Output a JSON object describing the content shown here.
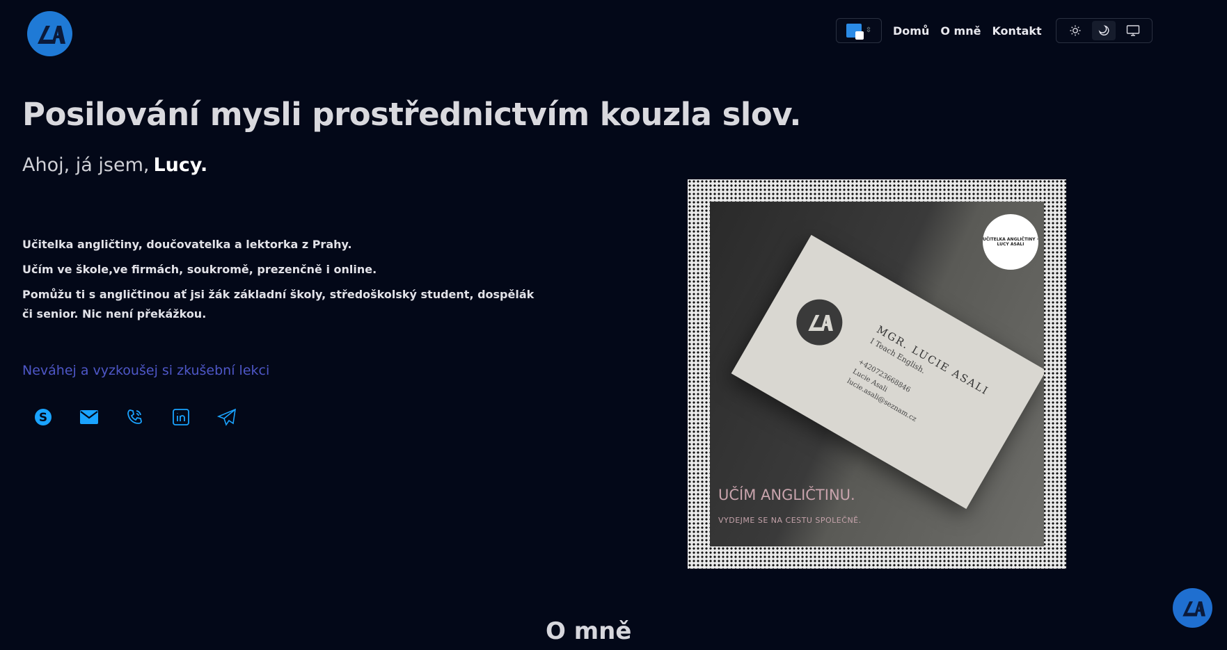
{
  "header": {
    "logo_icon": "la-monogram-logo",
    "language": {
      "icon": "google-translate-icon",
      "chevron": "⌃⌄"
    },
    "nav": [
      {
        "label": "Domů"
      },
      {
        "label": "O mně"
      },
      {
        "label": "Kontakt"
      }
    ],
    "theme_toggle": [
      {
        "icon": "sun-icon",
        "active": false
      },
      {
        "icon": "moon-icon",
        "active": true
      },
      {
        "icon": "monitor-icon",
        "active": false
      }
    ]
  },
  "hero": {
    "headline": "Posilování mysli prostřednictvím kouzla slov.",
    "greeting_prefix": "Ahoj, já jsem,",
    "greeting_name": "Lucy.",
    "paragraphs": [
      "Učitelka angličtiny, doučovatelka a lektorka z Prahy.",
      "Učím ve škole,ve firmách, soukromě, prezenčně i online.",
      "Pomůžu ti s angličtinou ať jsi žák základní školy, středoškolský student, dospělák či senior. Nic není překážkou."
    ],
    "cta": "Neváhej a vyzkoušej si zkušební lekci",
    "socials": [
      {
        "icon": "skype-icon"
      },
      {
        "icon": "email-icon"
      },
      {
        "icon": "phone-icon"
      },
      {
        "icon": "linkedin-icon"
      },
      {
        "icon": "telegram-icon"
      }
    ]
  },
  "image_card": {
    "badge_text": "UČITELKA ANGLIČTINY · LUCY ASALI",
    "card_title": "MGR. LUCIE ASALI",
    "card_subtitle": "I Teach English.",
    "card_phone": "+420723668846",
    "card_skype": "Lucie Asali",
    "card_email": "lucie.asali@seznam.cz",
    "heading": "UČÍM ANGLIČTINU.",
    "subheading": "VYDEJME SE NA CESTU SPOLEČNĚ."
  },
  "section": {
    "title": "O mně"
  },
  "colors": {
    "background": "#030818",
    "accent": "#1f7ad6",
    "cta": "#4e57c7"
  }
}
